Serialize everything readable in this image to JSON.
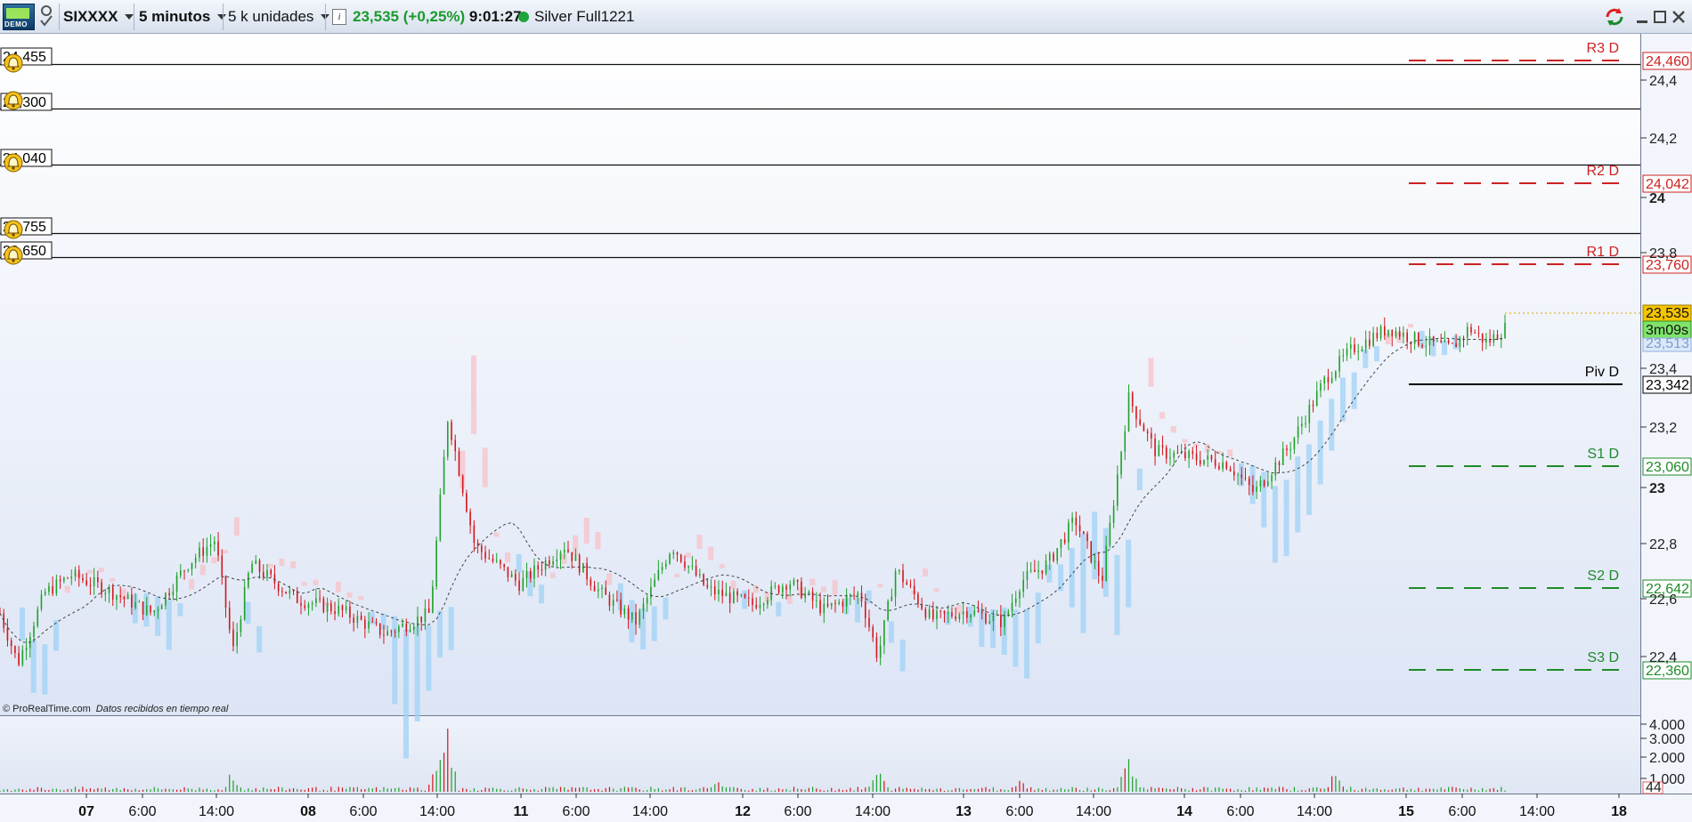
{
  "toolbar": {
    "demo_badge": "DEMO",
    "symbol": "SIXXXX",
    "timeframe": "5 minutos",
    "units": "5 k unidades",
    "info_icon": "i",
    "last_price": "23,535",
    "change": "(+0,25%)",
    "time": "9:01:27",
    "account": "Silver Full1221",
    "status_color": "#1fa33a",
    "price_color": "#1a9a2c"
  },
  "alerts": [
    {
      "label": "24,455"
    },
    {
      "label": "24,300"
    },
    {
      "label": "24,040"
    },
    {
      "label": "23,755"
    },
    {
      "label": "23,650"
    }
  ],
  "pivots": [
    {
      "name": "R3 D",
      "value": "24,460",
      "color": "#cc2222"
    },
    {
      "name": "R2 D",
      "value": "24,042",
      "color": "#cc2222"
    },
    {
      "name": "R1 D",
      "value": "23,760",
      "color": "#cc2222"
    },
    {
      "name": "Piv D",
      "value": "23,342",
      "color": "#000000"
    },
    {
      "name": "S1 D",
      "value": "23,060",
      "color": "#1f8a2a"
    },
    {
      "name": "S2 D",
      "value": "22,642",
      "color": "#1f8a2a"
    },
    {
      "name": "S3 D",
      "value": "22,360",
      "color": "#1f8a2a"
    }
  ],
  "price_axis": {
    "ticks": [
      "24,4",
      "24,2",
      "24",
      "23,8",
      "23,4",
      "23,2",
      "23",
      "22,8",
      "22,6",
      "22,4"
    ],
    "last_price_label": "23,535",
    "countdown_label": "3m09s",
    "cloud_label": "23,513"
  },
  "volume_axis": {
    "ticks": [
      "4.000",
      "3.000",
      "2.000",
      "1.000"
    ],
    "current_volume": "44"
  },
  "x_axis": {
    "labels": [
      "07",
      "6:00",
      "14:00",
      "08",
      "6:00",
      "14:00",
      "11",
      "6:00",
      "14:00",
      "12",
      "6:00",
      "14:00",
      "13",
      "6:00",
      "14:00",
      "14",
      "6:00",
      "14:00",
      "15",
      "6:00",
      "14:00",
      "18"
    ],
    "bold": [
      "07",
      "08",
      "11",
      "12",
      "13",
      "14",
      "15",
      "18"
    ]
  },
  "credit": {
    "brand": "© ProRealTime.com",
    "note": "Datos recibidos en tiempo real"
  },
  "chart_data": {
    "type": "candlestick",
    "title": "",
    "x_labels": [
      "07",
      "6:00",
      "14:00",
      "08",
      "6:00",
      "14:00",
      "11",
      "6:00",
      "14:00",
      "12",
      "6:00",
      "14:00",
      "13",
      "6:00",
      "14:00",
      "14",
      "6:00",
      "14:00",
      "15",
      "6:00",
      "14:00",
      "18"
    ],
    "price_path": [
      {
        "t": 0,
        "y": 22.55
      },
      {
        "t": 2,
        "y": 22.38
      },
      {
        "t": 5,
        "y": 22.62
      },
      {
        "t": 8,
        "y": 22.68
      },
      {
        "t": 12,
        "y": 22.63
      },
      {
        "t": 17,
        "y": 22.55
      },
      {
        "t": 21,
        "y": 22.72
      },
      {
        "t": 24,
        "y": 22.8
      },
      {
        "t": 26,
        "y": 22.42
      },
      {
        "t": 28,
        "y": 22.72
      },
      {
        "t": 33,
        "y": 22.6
      },
      {
        "t": 38,
        "y": 22.56
      },
      {
        "t": 43,
        "y": 22.48
      },
      {
        "t": 48,
        "y": 22.55
      },
      {
        "t": 50,
        "y": 23.22
      },
      {
        "t": 53,
        "y": 22.78
      },
      {
        "t": 58,
        "y": 22.65
      },
      {
        "t": 63,
        "y": 22.78
      },
      {
        "t": 67,
        "y": 22.62
      },
      {
        "t": 71,
        "y": 22.52
      },
      {
        "t": 75,
        "y": 22.78
      },
      {
        "t": 79,
        "y": 22.63
      },
      {
        "t": 84,
        "y": 22.58
      },
      {
        "t": 88,
        "y": 22.66
      },
      {
        "t": 92,
        "y": 22.56
      },
      {
        "t": 96,
        "y": 22.62
      },
      {
        "t": 98,
        "y": 22.4
      },
      {
        "t": 100,
        "y": 22.7
      },
      {
        "t": 104,
        "y": 22.53
      },
      {
        "t": 108,
        "y": 22.56
      },
      {
        "t": 112,
        "y": 22.52
      },
      {
        "t": 114,
        "y": 22.66
      },
      {
        "t": 117,
        "y": 22.72
      },
      {
        "t": 120,
        "y": 22.87
      },
      {
        "t": 123,
        "y": 22.66
      },
      {
        "t": 126,
        "y": 23.28
      },
      {
        "t": 129,
        "y": 23.1
      },
      {
        "t": 133,
        "y": 23.08
      },
      {
        "t": 137,
        "y": 23.06
      },
      {
        "t": 140,
        "y": 22.96
      },
      {
        "t": 144,
        "y": 23.12
      },
      {
        "t": 148,
        "y": 23.35
      },
      {
        "t": 151,
        "y": 23.45
      },
      {
        "t": 155,
        "y": 23.52
      },
      {
        "t": 158,
        "y": 23.48
      },
      {
        "t": 162,
        "y": 23.45
      },
      {
        "t": 164,
        "y": 23.52
      },
      {
        "t": 166,
        "y": 23.47
      },
      {
        "t": 168,
        "y": 23.52
      }
    ],
    "ylim": [
      22.25,
      24.52
    ],
    "volume_ylim": [
      0,
      4300
    ],
    "pivot_levels": {
      "R3 D": 24.46,
      "R2 D": 24.042,
      "R1 D": 23.76,
      "Piv D": 23.342,
      "S1 D": 23.06,
      "S2 D": 22.642,
      "S3 D": 22.36
    },
    "last_price": 23.535
  }
}
